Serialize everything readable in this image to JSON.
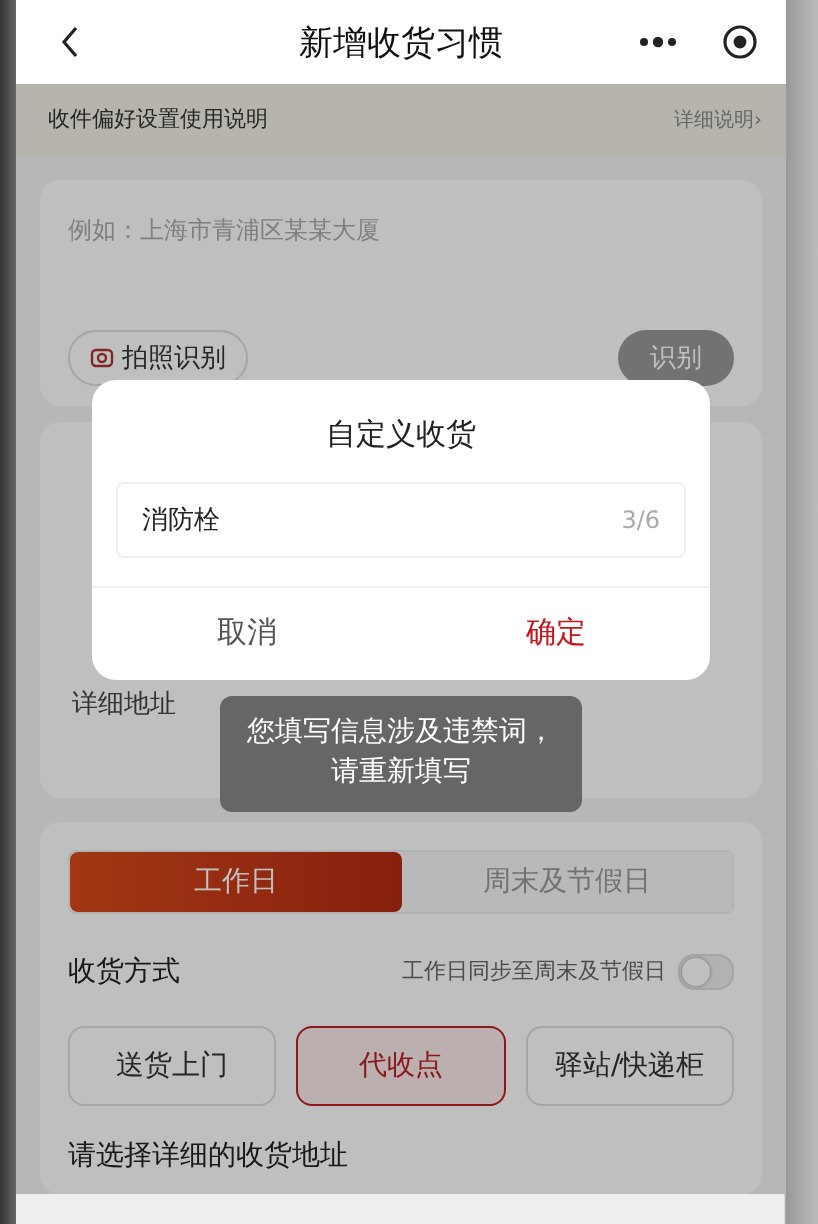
{
  "nav": {
    "title": "新增收货习惯"
  },
  "info_bar": {
    "text": "收件偏好设置使用说明",
    "link": "详细说明›"
  },
  "address_card": {
    "placeholder": "例如：上海市青浦区某某大厦",
    "photo_button": "拍照识别",
    "recognize_button": "识别"
  },
  "address_form": {
    "detail_label": "详细地址"
  },
  "receive_card": {
    "tabs": [
      {
        "label": "工作日",
        "selected": true
      },
      {
        "label": "周末及节假日",
        "selected": false
      }
    ],
    "method_label": "收货方式",
    "sync_label": "工作日同步至周末及节假日",
    "sync_on": false,
    "options": [
      {
        "label": "送货上门",
        "selected": false
      },
      {
        "label": "代收点",
        "selected": true
      },
      {
        "label": "驿站/快递柜",
        "selected": false
      }
    ],
    "address_prompt": "请选择详细的收货地址"
  },
  "dialog": {
    "title": "自定义收货",
    "value": "消防栓",
    "counter": "3/6",
    "cancel": "取消",
    "confirm": "确定"
  },
  "toast": {
    "text": "您填写信息涉及违禁词，请重新填写"
  }
}
